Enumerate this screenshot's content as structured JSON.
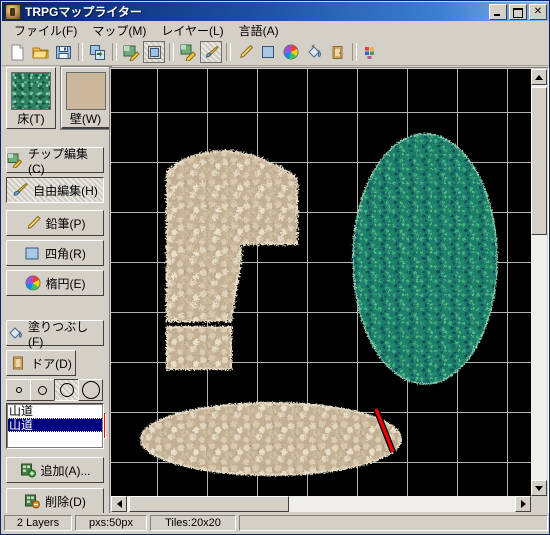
{
  "window": {
    "title": "TRPGマップライター",
    "icon": "app-icon",
    "buttons": {
      "minimize": "_",
      "maximize": "□",
      "close": "✕"
    }
  },
  "menubar": {
    "items": [
      {
        "label": "ファイル(F)",
        "accel": "F",
        "name": "menu-file"
      },
      {
        "label": "マップ(M)",
        "accel": "M",
        "name": "menu-map"
      },
      {
        "label": "レイヤー(L)",
        "accel": "L",
        "name": "menu-layer"
      },
      {
        "label": "言語(A)",
        "accel": "A",
        "name": "menu-language"
      }
    ]
  },
  "toolbar": {
    "items": [
      {
        "name": "new-file-icon",
        "selected": false
      },
      {
        "name": "open-folder-icon",
        "selected": false
      },
      {
        "name": "save-floppy-icon",
        "selected": false
      },
      {
        "sep": true
      },
      {
        "name": "export-image-icon",
        "selected": false
      },
      {
        "sep": true
      },
      {
        "name": "chip-edit-icon",
        "selected": false
      },
      {
        "name": "select-rect-icon",
        "selected": true
      },
      {
        "sep": true
      },
      {
        "name": "chip-pencil-icon",
        "selected": false
      },
      {
        "name": "free-brush-icon",
        "selected": true
      },
      {
        "sep": true
      },
      {
        "name": "pencil-icon",
        "selected": false
      },
      {
        "name": "rectangle-icon",
        "selected": false
      },
      {
        "name": "ellipse-color-wheel-icon",
        "selected": false
      },
      {
        "name": "paint-bucket-icon",
        "selected": false
      },
      {
        "name": "door-icon",
        "selected": false
      },
      {
        "sep": true
      },
      {
        "name": "palette-grid-icon",
        "selected": false
      }
    ]
  },
  "sidebar": {
    "texture_tabs": [
      {
        "label": "床(T)",
        "accel": "T",
        "swatch": "floor-grass-texture",
        "active": false,
        "name": "texture-tab-floor"
      },
      {
        "label": "壁(W)",
        "accel": "W",
        "swatch": "wall-stone-texture",
        "active": true,
        "name": "texture-tab-wall"
      }
    ],
    "tools": [
      {
        "label": "チップ編集(C)",
        "accel": "C",
        "icon": "chip-edit-icon",
        "pressed": false,
        "name": "tool-chip-edit"
      },
      {
        "label": "自由編集(H)",
        "accel": "H",
        "icon": "free-edit-brush-icon",
        "pressed": true,
        "name": "tool-free-edit"
      },
      {
        "label": "鉛筆(P)",
        "accel": "P",
        "icon": "pencil-icon",
        "pressed": false,
        "name": "tool-pencil"
      },
      {
        "label": "四角(R)",
        "accel": "R",
        "icon": "rectangle-icon",
        "pressed": false,
        "name": "tool-rectangle"
      },
      {
        "label": "楕円(E)",
        "accel": "E",
        "icon": "ellipse-icon",
        "pressed": false,
        "name": "tool-ellipse"
      },
      {
        "label": "塗りつぶし(F)",
        "accel": "F",
        "icon": "paint-bucket-icon",
        "pressed": false,
        "name": "tool-fill"
      },
      {
        "label": "ドア(D)",
        "accel": "D",
        "icon": "door-icon",
        "pressed": false,
        "name": "tool-door"
      }
    ],
    "door_color": "#ff0000",
    "brush_sizes": [
      {
        "dot": 4,
        "selected": false,
        "name": "brush-size-1"
      },
      {
        "dot": 8,
        "selected": false,
        "name": "brush-size-2"
      },
      {
        "dot": 13,
        "selected": true,
        "name": "brush-size-3"
      },
      {
        "dot": 17,
        "selected": false,
        "name": "brush-size-4"
      }
    ],
    "layers": [
      {
        "label": "山道",
        "selected": false
      },
      {
        "label": "山道",
        "selected": true
      }
    ],
    "layer_buttons": [
      {
        "label": "追加(A)...",
        "accel": "A",
        "icon": "layer-add-icon",
        "name": "layer-add-button"
      },
      {
        "label": "削除(D)",
        "accel": "D",
        "icon": "layer-delete-icon",
        "name": "layer-delete-button"
      }
    ]
  },
  "canvas": {
    "background": "#000000",
    "grid_color": "#b9b9b9",
    "grid_size_px": 50,
    "shapes": [
      {
        "name": "wall-blob-upper",
        "type": "wall-stone",
        "desc": "irregular rounded-top block, upper-left"
      },
      {
        "name": "wall-blob-lower",
        "type": "wall-stone",
        "desc": "horizontal ellipse, lower-left"
      },
      {
        "name": "floor-blob-right",
        "type": "floor-grass",
        "desc": "large vertical ellipse, right"
      },
      {
        "name": "door-marker",
        "type": "door",
        "color": "#ff0000",
        "desc": "red diagonal door segment"
      }
    ]
  },
  "scrollbars": {
    "vertical": {
      "thumb_top_pct": 4,
      "thumb_height_pct": 36
    },
    "horizontal": {
      "thumb_left_pct": 4,
      "thumb_width_pct": 38
    }
  },
  "statusbar": {
    "panes": [
      "2 Layers",
      "pxs:50px",
      "Tiles:20x20",
      ""
    ]
  }
}
